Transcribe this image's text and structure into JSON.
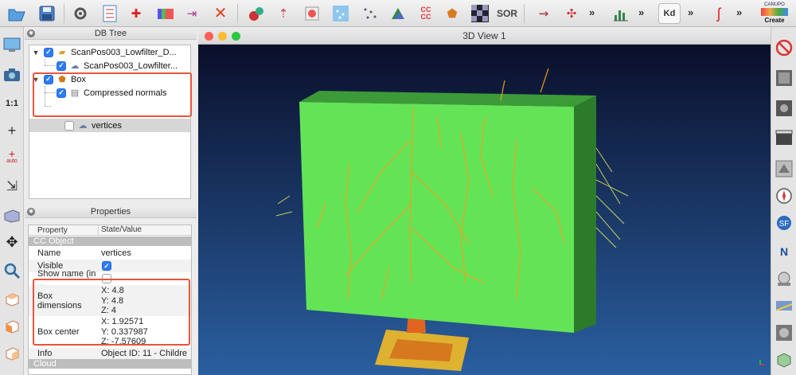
{
  "toolbar": {
    "more_glyph": "»",
    "sor_label": "SOR",
    "cc_label": "CC CC",
    "kd_label": "Kd",
    "canupo_label": "CANUPO",
    "create_label": "Create"
  },
  "left_toolbar": {
    "scale_label": "1:1",
    "auto_label": "auto"
  },
  "db_tree": {
    "title": "DB Tree",
    "items": [
      {
        "label": "ScanPos003_Lowfilter_D...",
        "checked": true,
        "expanded": true,
        "icon": "folder-icon"
      },
      {
        "label": "ScanPos003_Lowfilter...",
        "checked": true,
        "icon": "cloud-icon"
      },
      {
        "label": "Box",
        "checked": true,
        "expanded": true,
        "icon": "mesh-icon"
      },
      {
        "label": "Compressed normals",
        "checked": true,
        "icon": "normals-icon"
      },
      {
        "label": "vertices",
        "checked": false,
        "icon": "cloud-icon",
        "selected": true
      }
    ]
  },
  "properties": {
    "title": "Properties",
    "col_property": "Property",
    "col_value": "State/Value",
    "section_cc_object": "CC Object",
    "rows": {
      "name": {
        "key": "Name",
        "value": "vertices"
      },
      "visible": {
        "key": "Visible",
        "checked": true
      },
      "show_name": {
        "key": "Show name (in ...",
        "checked": false
      },
      "box_dimensions": {
        "key": "Box dimensions",
        "x": "X: 4.8",
        "y": "Y: 4.8",
        "z": "Z: 4"
      },
      "box_center": {
        "key": "Box center",
        "x": "X: 1.92571",
        "y": "Y: 0.337987",
        "z": "Z: -7.57609"
      },
      "info": {
        "key": "Info",
        "value": "Object ID: 11 - Childre"
      }
    },
    "section_cloud": "Cloud"
  },
  "view3d": {
    "title": "3D View 1",
    "colors": {
      "background_top": "#0a0f2a",
      "background_bottom": "#2a5fa0",
      "box_front": "#63e457",
      "box_side": "#2c7b2a",
      "box_top": "#3d9a38",
      "points": "#f0a020"
    }
  },
  "colors": {
    "highlight": "#e8553a",
    "selection_blue": "#1e6fe0",
    "checkbox_blue": "#2d7cf6"
  }
}
